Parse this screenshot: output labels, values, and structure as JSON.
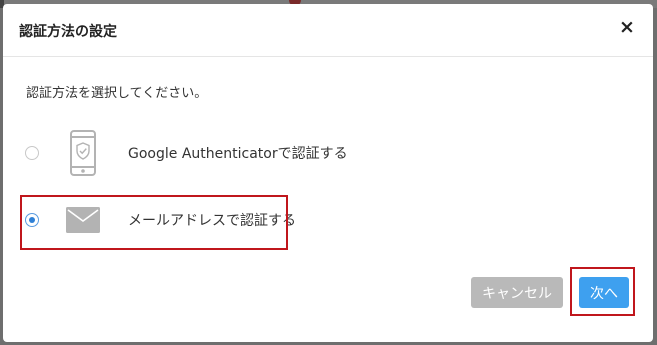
{
  "dialog": {
    "title": "認証方法の設定",
    "close_label": "×",
    "instruction": "認証方法を選択してください。",
    "options": [
      {
        "label": "Google Authenticatorで認証する",
        "icon": "smartphone-shield-icon",
        "selected": false
      },
      {
        "label": "メールアドレスで認証する",
        "icon": "envelope-icon",
        "selected": true
      }
    ],
    "buttons": {
      "cancel_label": "キャンセル",
      "next_label": "次へ"
    }
  },
  "colors": {
    "primary": "#3ea0ef",
    "disabled": "#b9b9b9",
    "highlight": "#c0161c",
    "icon": "#b3b3b3"
  }
}
